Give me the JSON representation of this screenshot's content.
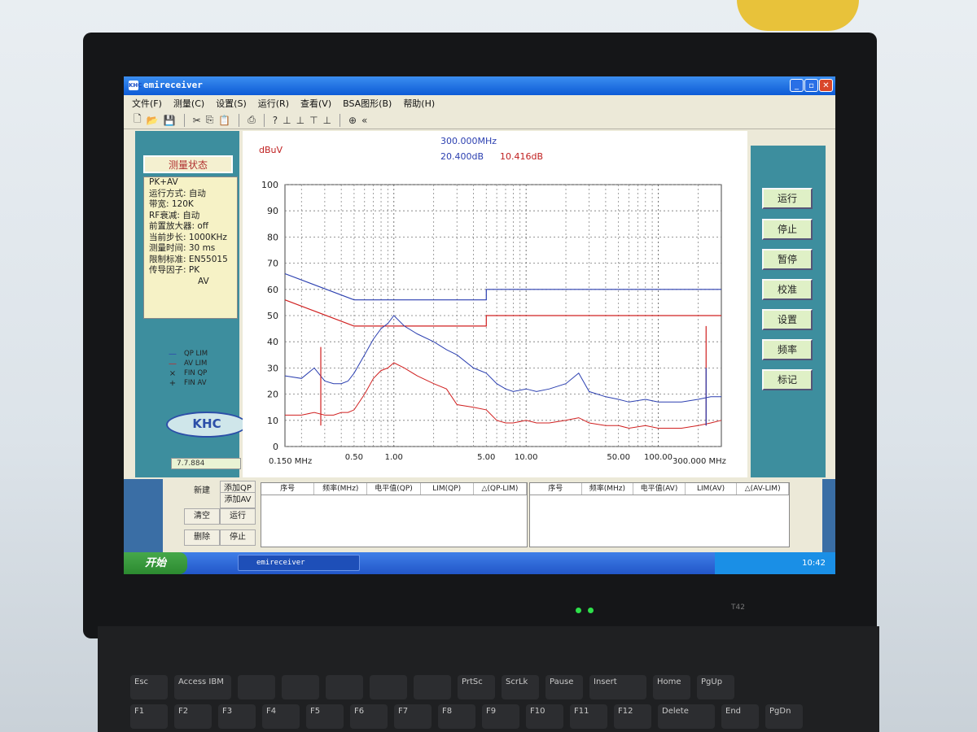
{
  "window": {
    "title": "emireceiver",
    "icon_label": "KHC"
  },
  "menu": [
    "文件(F)",
    "测量(C)",
    "设置(S)",
    "运行(R)",
    "查看(V)",
    "BSA图形(B)",
    "帮助(H)"
  ],
  "status_panel": {
    "title": "测量状态",
    "lines": [
      "PK+AV",
      "运行方式: 自动",
      "带宽: 120K",
      "RF衰减: 自动",
      "前置放大器: off",
      "当前步长: 1000KHz",
      "测量时间: 30 ms",
      "限制标准: EN55015",
      "传导因子: PK",
      "AV"
    ]
  },
  "legend": [
    {
      "mark": "—",
      "label": "QP LIM",
      "color": "#2b3fb0"
    },
    {
      "mark": "—",
      "label": "AV LIM",
      "color": "#d02020"
    },
    {
      "mark": "×",
      "label": "FIN QP",
      "color": "#222222"
    },
    {
      "mark": "+",
      "label": "FIN AV",
      "color": "#222222"
    }
  ],
  "logo_text": "KHC",
  "version": "7.7.884",
  "marker": {
    "freq": "300.000MHz",
    "qp": "20.400dB",
    "av": "10.416dB"
  },
  "chart_data": {
    "type": "line",
    "ylabel": "dBuV",
    "ylim": [
      0,
      100
    ],
    "yticks": [
      0,
      10,
      20,
      30,
      40,
      50,
      60,
      70,
      80,
      90,
      100
    ],
    "xscale": "log",
    "xlim": [
      0.15,
      300
    ],
    "xticks": [
      {
        "value": 0.5,
        "label": "0.50"
      },
      {
        "value": 1,
        "label": "1.00"
      },
      {
        "value": 5,
        "label": "5.00"
      },
      {
        "value": 10,
        "label": "10.00"
      },
      {
        "value": 50,
        "label": "50.00"
      },
      {
        "value": 100,
        "label": "100.00"
      }
    ],
    "x_start_label": "0.150 MHz",
    "x_end_label": "300.000 MHz",
    "grid": true,
    "series": [
      {
        "name": "QP LIM",
        "color": "#2b3fb0",
        "x": [
          0.15,
          0.5,
          5,
          5,
          300
        ],
        "y": [
          66,
          56,
          56,
          60,
          60
        ]
      },
      {
        "name": "AV LIM",
        "color": "#d02020",
        "x": [
          0.15,
          0.5,
          5,
          5,
          300
        ],
        "y": [
          56,
          46,
          46,
          50,
          50
        ]
      },
      {
        "name": "PK",
        "color": "#2b3fb0",
        "x": [
          0.15,
          0.2,
          0.25,
          0.3,
          0.35,
          0.4,
          0.45,
          0.5,
          0.6,
          0.7,
          0.8,
          0.9,
          1.0,
          1.2,
          1.5,
          2,
          2.5,
          3,
          4,
          5,
          6,
          7,
          8,
          10,
          12,
          15,
          20,
          25,
          30,
          40,
          50,
          60,
          80,
          100,
          150,
          200,
          250,
          300
        ],
        "y": [
          27,
          26,
          30,
          25,
          24,
          24,
          25,
          28,
          35,
          41,
          45,
          47,
          50,
          46,
          43,
          40,
          37,
          35,
          30,
          28,
          24,
          22,
          21,
          22,
          21,
          22,
          24,
          28,
          21,
          19,
          18,
          17,
          18,
          17,
          17,
          18,
          19,
          19
        ]
      },
      {
        "name": "AV",
        "color": "#d02020",
        "x": [
          0.15,
          0.2,
          0.25,
          0.3,
          0.35,
          0.4,
          0.45,
          0.5,
          0.6,
          0.7,
          0.8,
          0.9,
          1.0,
          1.2,
          1.5,
          2,
          2.5,
          3,
          4,
          5,
          6,
          7,
          8,
          10,
          12,
          15,
          20,
          25,
          30,
          40,
          50,
          60,
          80,
          100,
          150,
          200,
          250,
          300
        ],
        "y": [
          12,
          12,
          13,
          12,
          12,
          13,
          13,
          14,
          20,
          26,
          29,
          30,
          32,
          30,
          27,
          24,
          22,
          16,
          15,
          14,
          10,
          9,
          9,
          10,
          9,
          9,
          10,
          11,
          9,
          8,
          8,
          7,
          8,
          7,
          7,
          8,
          9,
          10
        ]
      }
    ],
    "spikes": [
      {
        "color": "#d02020",
        "x": 0.28,
        "y": 38
      },
      {
        "color": "#d02020",
        "x": 230,
        "y": 46
      },
      {
        "color": "#2b3fb0",
        "x": 230,
        "y": 30
      }
    ]
  },
  "buttons": [
    "运行",
    "停止",
    "暂停",
    "校准",
    "设置",
    "频率",
    "标记"
  ],
  "ops": {
    "new": "新建",
    "add_qp": "添加QP",
    "add_av": "添加AV",
    "clear": "清空",
    "run": "运行",
    "delete": "删除",
    "stop": "停止"
  },
  "table_qp_headers": [
    "序号",
    "频率(MHz)",
    "电平值(QP)",
    "LIM(QP)",
    "△(QP-LIM)"
  ],
  "table_av_headers": [
    "序号",
    "频率(MHz)",
    "电平值(AV)",
    "LIM(AV)",
    "△(AV-LIM)"
  ],
  "taskbar": {
    "start": "开始",
    "task": "emireceiver",
    "clock": "10:42"
  },
  "keyboard": {
    "row1": [
      "Esc",
      "Access IBM",
      "",
      "",
      "",
      "",
      "",
      "PrtSc",
      "ScrLk",
      "Pause",
      "Insert",
      "Home",
      "PgUp"
    ],
    "row2": [
      "F1",
      "F2",
      "F3",
      "F4",
      "F5",
      "F6",
      "F7",
      "F8",
      "F9",
      "F10",
      "F11",
      "F12",
      "Delete",
      "End",
      "PgDn"
    ]
  },
  "bezel_model": "T42"
}
